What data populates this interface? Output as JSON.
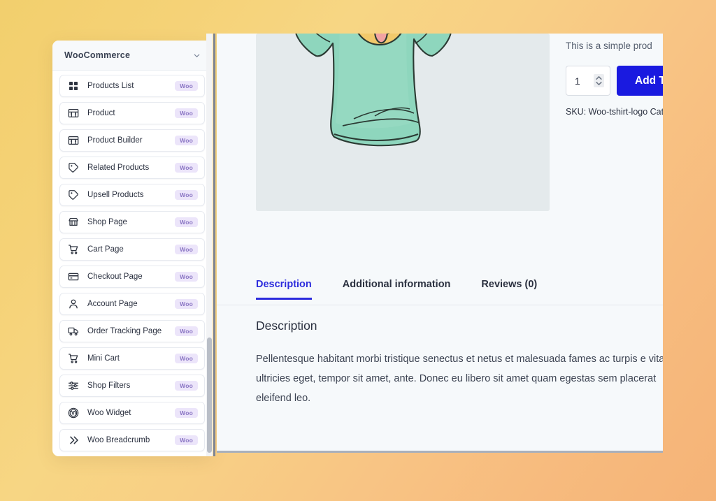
{
  "background": {
    "gradient_from": "#f2cf6d",
    "gradient_to": "#f5b377"
  },
  "sidebar": {
    "header": {
      "title": "WooCommerce",
      "collapse_icon": "chevron-down-icon"
    },
    "badge_label": "Woo",
    "badge_bg": "#ece5fa",
    "badge_color": "#8b76c4",
    "items": [
      {
        "label": "Products List",
        "icon": "grid-icon",
        "badge": "Woo"
      },
      {
        "label": "Product",
        "icon": "product-box-icon",
        "badge": "Woo"
      },
      {
        "label": "Product Builder",
        "icon": "product-box-icon",
        "badge": "Woo"
      },
      {
        "label": "Related Products",
        "icon": "tag-icon",
        "badge": "Woo"
      },
      {
        "label": "Upsell Products",
        "icon": "tag-icon",
        "badge": "Woo"
      },
      {
        "label": "Shop Page",
        "icon": "storefront-icon",
        "badge": "Woo"
      },
      {
        "label": "Cart Page",
        "icon": "cart-icon",
        "badge": "Woo"
      },
      {
        "label": "Checkout Page",
        "icon": "credit-card-icon",
        "badge": "Woo"
      },
      {
        "label": "Account Page",
        "icon": "user-icon",
        "badge": "Woo"
      },
      {
        "label": "Order Tracking Page",
        "icon": "truck-icon",
        "badge": "Woo"
      },
      {
        "label": "Mini Cart",
        "icon": "cart-icon",
        "badge": "Woo"
      },
      {
        "label": "Shop Filters",
        "icon": "sliders-icon",
        "badge": "Woo"
      },
      {
        "label": "Woo Widget",
        "icon": "wordpress-icon",
        "badge": "Woo"
      },
      {
        "label": "Woo Breadcrumb",
        "icon": "chevrons-right-icon",
        "badge": "Woo"
      }
    ]
  },
  "main": {
    "product": {
      "image_alt": "green t-shirt with winking emoji logo",
      "simple_product_note": "This is a simple prod",
      "quantity_value": "1",
      "add_to_cart_label": "Add T",
      "add_to_cart_color": "#1a1ae0",
      "sku_line": "SKU: Woo-tshirt-logo Cat"
    },
    "tabs": [
      {
        "label": "Description",
        "active": true
      },
      {
        "label": "Additional information",
        "active": false
      },
      {
        "label": "Reviews (0)",
        "active": false
      }
    ],
    "description": {
      "heading": "Description",
      "body": "Pellentesque habitant morbi tristique senectus et netus et malesuada fames ac turpis e vitae, ultricies eget, tempor sit amet, ante. Donec eu libero sit amet quam egestas sem placerat eleifend leo."
    }
  }
}
